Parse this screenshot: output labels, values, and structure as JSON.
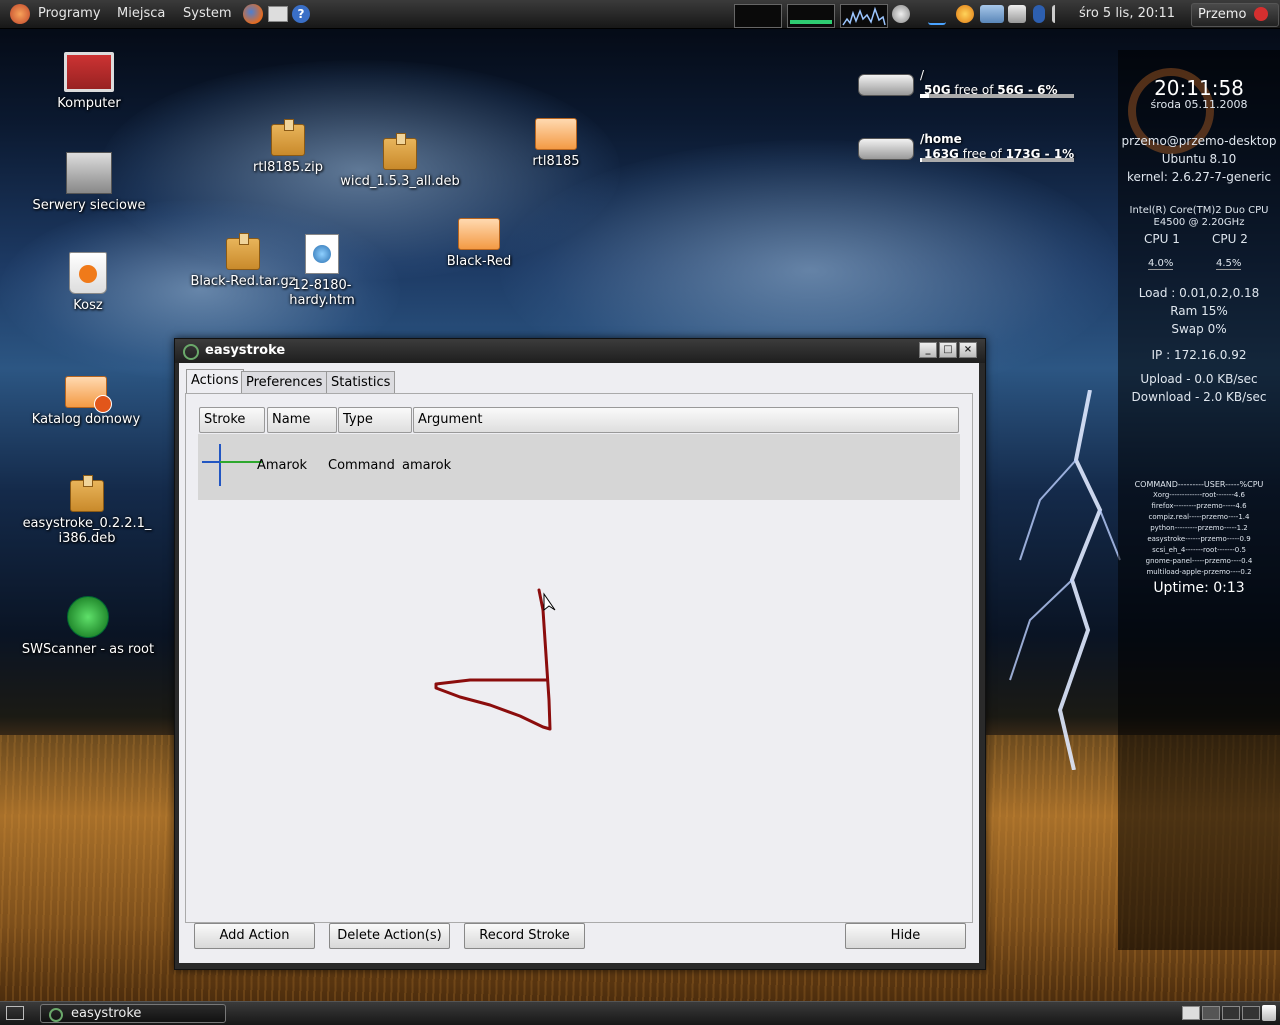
{
  "top_panel": {
    "menus": [
      "Programy",
      "Miejsca",
      "System"
    ],
    "clock": "śro  5 lis, 20:11",
    "user": "Przemo"
  },
  "desktop_icons": [
    {
      "label": "Komputer",
      "icon": "computer-icon"
    },
    {
      "label": "Serwery sieciowe",
      "icon": "network-servers-icon"
    },
    {
      "label": "Kosz",
      "icon": "trash-icon"
    },
    {
      "label": "Katalog domowy",
      "icon": "home-folder-icon"
    },
    {
      "label": "easystroke_0.2.2.1_",
      "label2": "i386.deb",
      "icon": "package-icon"
    },
    {
      "label": "SWScanner - as root",
      "icon": "scanner-icon"
    },
    {
      "label": "rtl8185.zip",
      "icon": "package-icon"
    },
    {
      "label": "wicd_1.5.3_all.deb",
      "icon": "package-icon"
    },
    {
      "label": "rtl8185",
      "icon": "folder-icon"
    },
    {
      "label": "Black-Red.tar.gz",
      "icon": "package-icon"
    },
    {
      "label": "12-8180-hardy.htm",
      "icon": "html-file-icon"
    },
    {
      "label": "Black-Red",
      "icon": "folder-icon"
    }
  ],
  "disks": [
    {
      "mount": "/",
      "free": "50G",
      "mid": " free of ",
      "total": "56G - 6%"
    },
    {
      "mount": "/home",
      "free": "163G",
      "mid": " free of ",
      "total": "173G - 1%"
    }
  ],
  "conky": {
    "time": "20:11:58",
    "date": "środa 05.11.2008",
    "user": "przemo@przemo-desktop",
    "os": "Ubuntu 8.10",
    "kernel": "kernel: 2.6.27-7-generic",
    "cpu_model": "Intel(R) Core(TM)2 Duo CPU",
    "cpu_model2": "E4500  @ 2.20GHz",
    "cpu1_label": "CPU 1",
    "cpu2_label": "CPU 2",
    "cpu1_val": "4.0%",
    "cpu2_val": "4.5%",
    "load": "Load : 0.01,0.2,0.18",
    "ram": "Ram 15%",
    "swap": "Swap 0%",
    "ip": "IP : 172.16.0.92",
    "upload": "Upload - 0.0 KB/sec",
    "download": "Download - 2.0 KB/sec",
    "proc_header": "COMMAND---------USER-----%CPU",
    "procs": [
      "Xorg-------------root-------4.6",
      "firefox---------przemo-----4.6",
      "compiz.real-----przemo----1.4",
      "python---------przemo-----1.2",
      "easystroke------przemo-----0.9",
      "scsi_eh_4-------root-------0.5",
      "gnome-panel-----przemo----0.4",
      "multiload-apple-przemo----0.2"
    ],
    "uptime": "Uptime: 0:13"
  },
  "window": {
    "title": "easystroke",
    "tabs": [
      "Actions",
      "Preferences",
      "Statistics"
    ],
    "columns": [
      "Stroke",
      "Name",
      "Type",
      "Argument"
    ],
    "rows": [
      {
        "name": "Amarok",
        "type": "Command",
        "argument": "amarok"
      }
    ],
    "buttons": {
      "add": "Add Action",
      "delete": "Delete Action(s)",
      "record": "Record Stroke",
      "hide": "Hide"
    }
  },
  "bottom_panel": {
    "task": "easystroke"
  },
  "colors": {
    "stroke": "#8b0d0d",
    "panel": "#222222",
    "window_bg": "#eeeef2"
  }
}
